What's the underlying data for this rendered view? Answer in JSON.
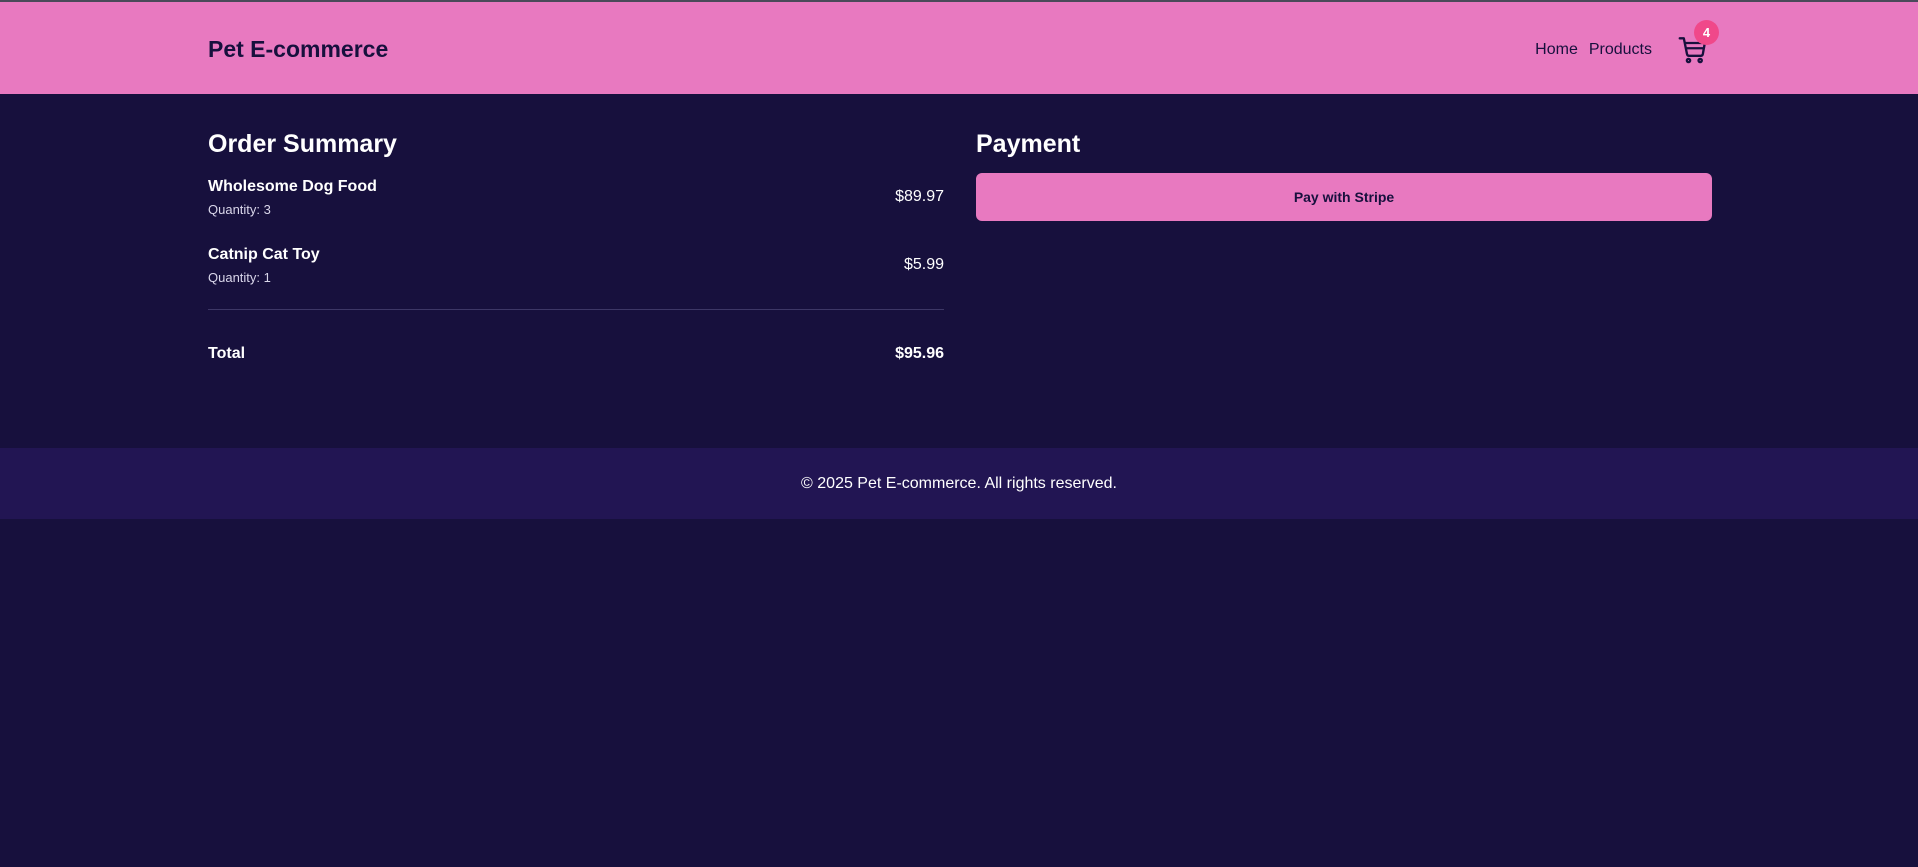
{
  "header": {
    "brand": "Pet E-commerce",
    "nav": [
      {
        "label": "Home"
      },
      {
        "label": "Products"
      }
    ],
    "cart": {
      "icon": "cart-icon",
      "count": "4"
    }
  },
  "order_summary": {
    "title": "Order Summary",
    "items": [
      {
        "name": "Wholesome Dog Food",
        "quantity": "Quantity: 3",
        "price": "$89.97"
      },
      {
        "name": "Catnip Cat Toy",
        "quantity": "Quantity: 1",
        "price": "$5.99"
      }
    ],
    "total_label": "Total",
    "total_value": "$95.96"
  },
  "payment": {
    "title": "Payment",
    "button_label": "Pay with Stripe"
  },
  "footer": {
    "text": "© 2025 Pet E-commerce. All rights reserved."
  },
  "colors": {
    "accent": "#e879c0",
    "background": "#17103d",
    "footer_bg": "#221553",
    "badge": "#f0488a"
  }
}
